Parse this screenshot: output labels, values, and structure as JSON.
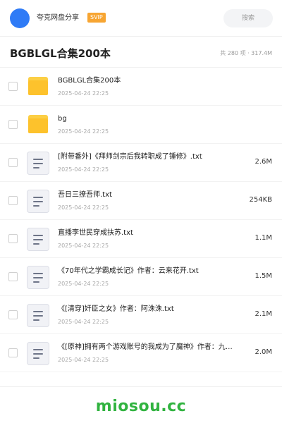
{
  "header": {
    "app_name": "夸克网盘分享",
    "badge": "SVIP",
    "search_placeholder": "搜索"
  },
  "folder": {
    "title": "BGBLGL合集200本",
    "meta": "共 280 项 · 317.4M"
  },
  "files": [
    {
      "type": "folder",
      "icon": "folder-icon",
      "name": "BGBLGL合集200本",
      "date": "2025-04-24 22:25",
      "size": ""
    },
    {
      "type": "folder",
      "icon": "folder-icon",
      "name": "bg",
      "date": "2025-04-24 22:25",
      "size": ""
    },
    {
      "type": "txt",
      "icon": "text-file-icon",
      "name": "[附带番外]《拜师剑宗后我转职成了锤修》.txt",
      "date": "2025-04-24 22:25",
      "size": "2.6M"
    },
    {
      "type": "txt",
      "icon": "text-file-icon",
      "name": "吾日三撩吾师.txt",
      "date": "2025-04-24 22:25",
      "size": "254KB"
    },
    {
      "type": "txt",
      "icon": "text-file-icon",
      "name": "直播李世民穿成扶苏.txt",
      "date": "2025-04-24 22:25",
      "size": "1.1M"
    },
    {
      "type": "txt",
      "icon": "text-file-icon",
      "name": "《70年代之学霸成长记》作者：云来花开.txt",
      "date": "2025-04-24 22:25",
      "size": "1.5M"
    },
    {
      "type": "txt",
      "icon": "text-file-icon",
      "name": "《[清穿]奸臣之女》作者：阿洙洙.txt",
      "date": "2025-04-24 22:25",
      "size": "2.1M"
    },
    {
      "type": "txt",
      "icon": "text-file-icon",
      "name": "《[原神]拥有两个游戏账号的我成为了魔神》作者：九…",
      "date": "2025-04-24 22:25",
      "size": "2.0M"
    }
  ],
  "footer": {
    "watermark": "miosou.cc"
  },
  "colors": {
    "accent": "#2f7bf6",
    "badge": "#f7a532",
    "folder": "#fdc22c",
    "watermark": "#31b340"
  }
}
